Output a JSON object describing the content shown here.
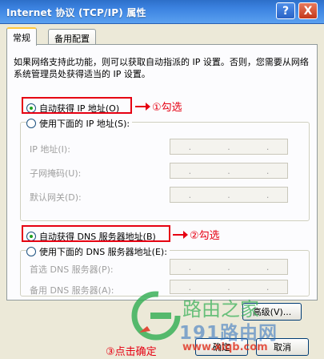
{
  "window": {
    "title": "Internet 协议 (TCP/IP) 属性",
    "help_glyph": "?",
    "close_glyph": "X"
  },
  "tabs": [
    {
      "label": "常规",
      "active": true
    },
    {
      "label": "备用配置",
      "active": false
    }
  ],
  "description": "如果网络支持此功能，则可以获取自动指派的 IP 设置。否则，您需要从网络系统管理员处获得适当的 IP 设置。",
  "ip": {
    "auto_label": "自动获得 IP 地址(O)",
    "manual_label": "使用下面的 IP 地址(S):",
    "fields": [
      {
        "label": "IP 地址(I):"
      },
      {
        "label": "子网掩码(U):"
      },
      {
        "label": "默认网关(D):"
      }
    ],
    "selected": "auto"
  },
  "dns": {
    "auto_label": "自动获得 DNS 服务器地址(B)",
    "manual_label": "使用下面的 DNS 服务器地址(E):",
    "fields": [
      {
        "label": "首选 DNS 服务器(P):"
      },
      {
        "label": "备用 DNS 服务器(A):"
      }
    ],
    "selected": "auto"
  },
  "dot_glyph": ".",
  "annotations": {
    "step1": "①勾选",
    "step2": "②勾选",
    "step3": "③点击确定"
  },
  "buttons": {
    "advanced": "高级(V)...",
    "ok": "确定",
    "cancel": "取消"
  },
  "watermark": {
    "line1": "路由之家",
    "line2": "191路由网",
    "url": "www.xiqb.com"
  },
  "colors": {
    "titlebar": "#3b82e0",
    "dialog_bg": "#ece9d8",
    "annotation_red": "#e60012",
    "radio_checked": "#21a121"
  }
}
